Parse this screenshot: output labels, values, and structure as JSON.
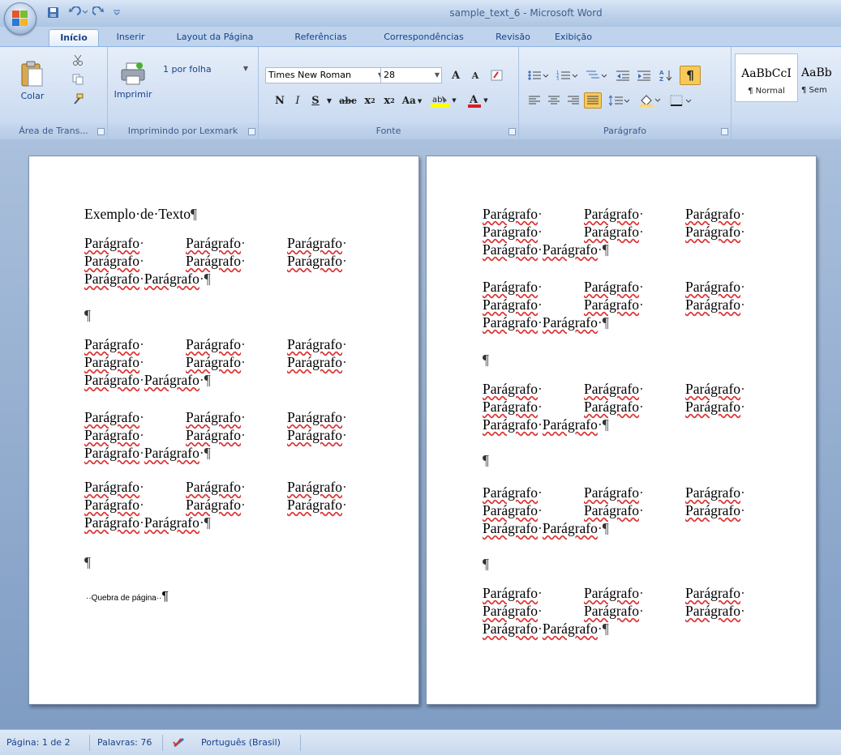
{
  "window": {
    "title": "sample_text_6 - Microsoft Word"
  },
  "tabs": [
    "Início",
    "Inserir",
    "Layout da Página",
    "Referências",
    "Correspondências",
    "Revisão",
    "Exibição"
  ],
  "ribbon": {
    "clipboard": {
      "paste_label": "Colar",
      "group_label": "Área de Trans..."
    },
    "print": {
      "print_label": "Imprimir",
      "pages_per_sheet": "1 por folha",
      "group_label": "Imprimindo por Lexmark"
    },
    "font": {
      "name": "Times New Roman",
      "size": "28",
      "group_label": "Fonte",
      "grow_label": "A",
      "shrink_label": "A",
      "case_label": "Aa",
      "bold": "N",
      "italic": "I",
      "underline": "S",
      "strike": "abc",
      "subscript": "x",
      "superscript": "x"
    },
    "paragraph": {
      "group_label": "Parágrafo"
    },
    "styles": [
      {
        "sample": "AaBbCcI",
        "name": "¶ Normal"
      },
      {
        "sample": "AaBb",
        "name": "¶ Sem"
      }
    ]
  },
  "document": {
    "heading": "Exemplo·de·Texto",
    "word": "Parágrafo",
    "pilcrow": "¶",
    "page_break": "Quebra de página"
  },
  "status": {
    "page": "Página: 1 de 2",
    "words": "Palavras: 76",
    "language": "Português (Brasil)"
  }
}
